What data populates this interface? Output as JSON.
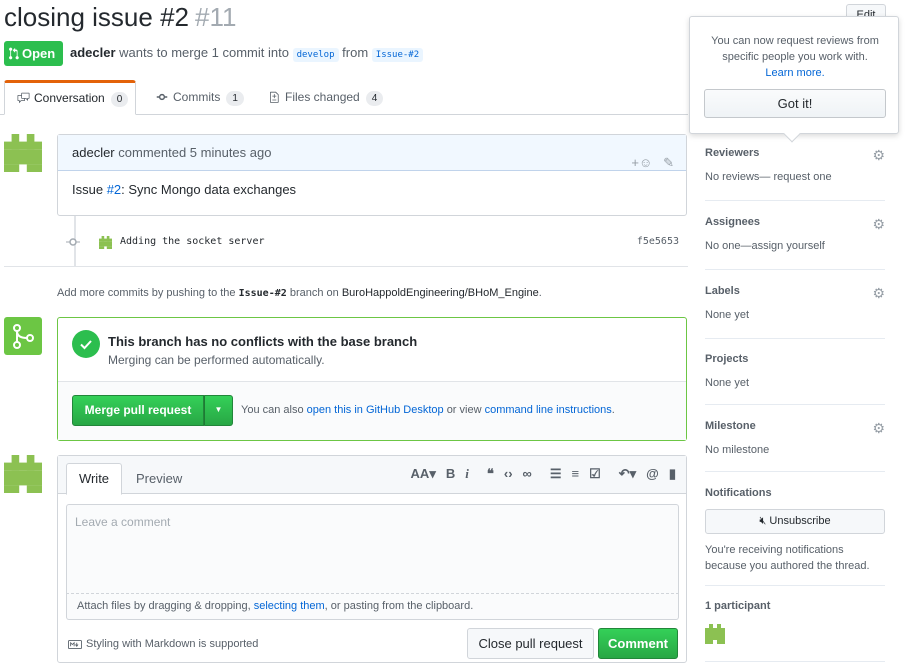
{
  "header": {
    "title": "closing issue #2",
    "number": "#11",
    "edit_label": "Edit"
  },
  "status": {
    "state": "Open",
    "author": "adecler",
    "text_mid": "wants to merge 1 commit into",
    "base_branch": "develop",
    "text_from": "from",
    "head_branch": "Issue-#2"
  },
  "tabs": [
    {
      "label": "Conversation",
      "count": "0"
    },
    {
      "label": "Commits",
      "count": "1"
    },
    {
      "label": "Files changed",
      "count": "4"
    }
  ],
  "comment": {
    "author": "adecler",
    "action": "commented 5 minutes ago",
    "body_prefix": "Issue ",
    "body_link": "#2",
    "body_suffix": ": Sync Mongo data exchanges"
  },
  "commit": {
    "message": "Adding the socket server",
    "sha": "f5e5653"
  },
  "push_note": {
    "prefix": "Add more commits by pushing to the",
    "branch": "Issue-#2",
    "middle": "branch on",
    "repo": "BuroHappoldEngineering/BHoM_Engine",
    "suffix": "."
  },
  "merge": {
    "title": "This branch has no conflicts with the base branch",
    "subtitle": "Merging can be performed automatically.",
    "button_label": "Merge pull request",
    "alt_prefix": "You can also",
    "alt_link1": "open this in GitHub Desktop",
    "alt_middle": "or view",
    "alt_link2": "command line instructions",
    "alt_suffix": "."
  },
  "editor": {
    "tab_write": "Write",
    "tab_preview": "Preview",
    "placeholder": "Leave a comment",
    "attach_prefix": "Attach files by dragging & dropping,",
    "attach_link": "selecting them",
    "attach_suffix": ", or pasting from the clipboard.",
    "markdown_note": "Styling with Markdown is supported",
    "close_label": "Close pull request",
    "comment_label": "Comment"
  },
  "sidebar": {
    "reviewers": {
      "title": "Reviewers",
      "value": "No reviews— request one"
    },
    "assignees": {
      "title": "Assignees",
      "value": "No one—assign yourself"
    },
    "labels": {
      "title": "Labels",
      "value": "None yet"
    },
    "projects": {
      "title": "Projects",
      "value": "None yet"
    },
    "milestone": {
      "title": "Milestone",
      "value": "No milestone"
    },
    "notifications": {
      "title": "Notifications",
      "button": "Unsubscribe",
      "note": "You're receiving notifications because you authored the thread."
    },
    "participants": {
      "title": "1 participant"
    }
  },
  "popover": {
    "text": "You can now request reviews from specific people you work with.",
    "link": "Learn more.",
    "button": "Got it!"
  },
  "colors": {
    "open_green": "#2cbe4e",
    "link_blue": "#0366d6",
    "avatar_green": "#8cc152",
    "merge_border": "#6cc644"
  }
}
